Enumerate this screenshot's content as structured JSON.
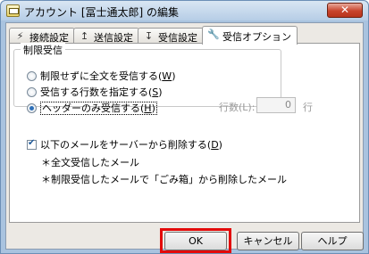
{
  "window": {
    "title": "アカウント [冨士通太郎] の編集",
    "close_symbol": "✕"
  },
  "tabs": [
    {
      "label": "接続設定",
      "icon": "antenna-icon",
      "glyph": "⚡"
    },
    {
      "label": "送信設定",
      "icon": "send-icon",
      "glyph": "↥"
    },
    {
      "label": "受信設定",
      "icon": "receive-icon",
      "glyph": "↧"
    },
    {
      "label": "受信オプション",
      "icon": "wrench-icon",
      "glyph": "🔧",
      "active": true
    }
  ],
  "limit_group": {
    "title": "制限受信",
    "options": [
      {
        "label": "制限せずに全文を受信する(",
        "key": "W",
        "tail": ")",
        "selected": false
      },
      {
        "label": "受信する行数を指定する(",
        "key": "S",
        "tail": ")",
        "selected": false
      },
      {
        "label": "ヘッダーのみ受信する(",
        "key": "H",
        "tail": ")",
        "selected": true
      }
    ],
    "row_count": {
      "label": "行数(L):",
      "value": "0",
      "unit": "行"
    }
  },
  "delete_option": {
    "label": "以下のメールをサーバーから削除する(",
    "key": "D",
    "tail": ")",
    "checked": true,
    "bullets": [
      "＊全文受信したメール",
      "＊制限受信したメールで「ごみ箱」から削除したメール"
    ]
  },
  "buttons": {
    "ok": "OK",
    "cancel": "キャンセル",
    "help": "ヘルプ"
  },
  "colors": {
    "highlight": "#e30a0a",
    "accent": "#2d6fb8"
  }
}
